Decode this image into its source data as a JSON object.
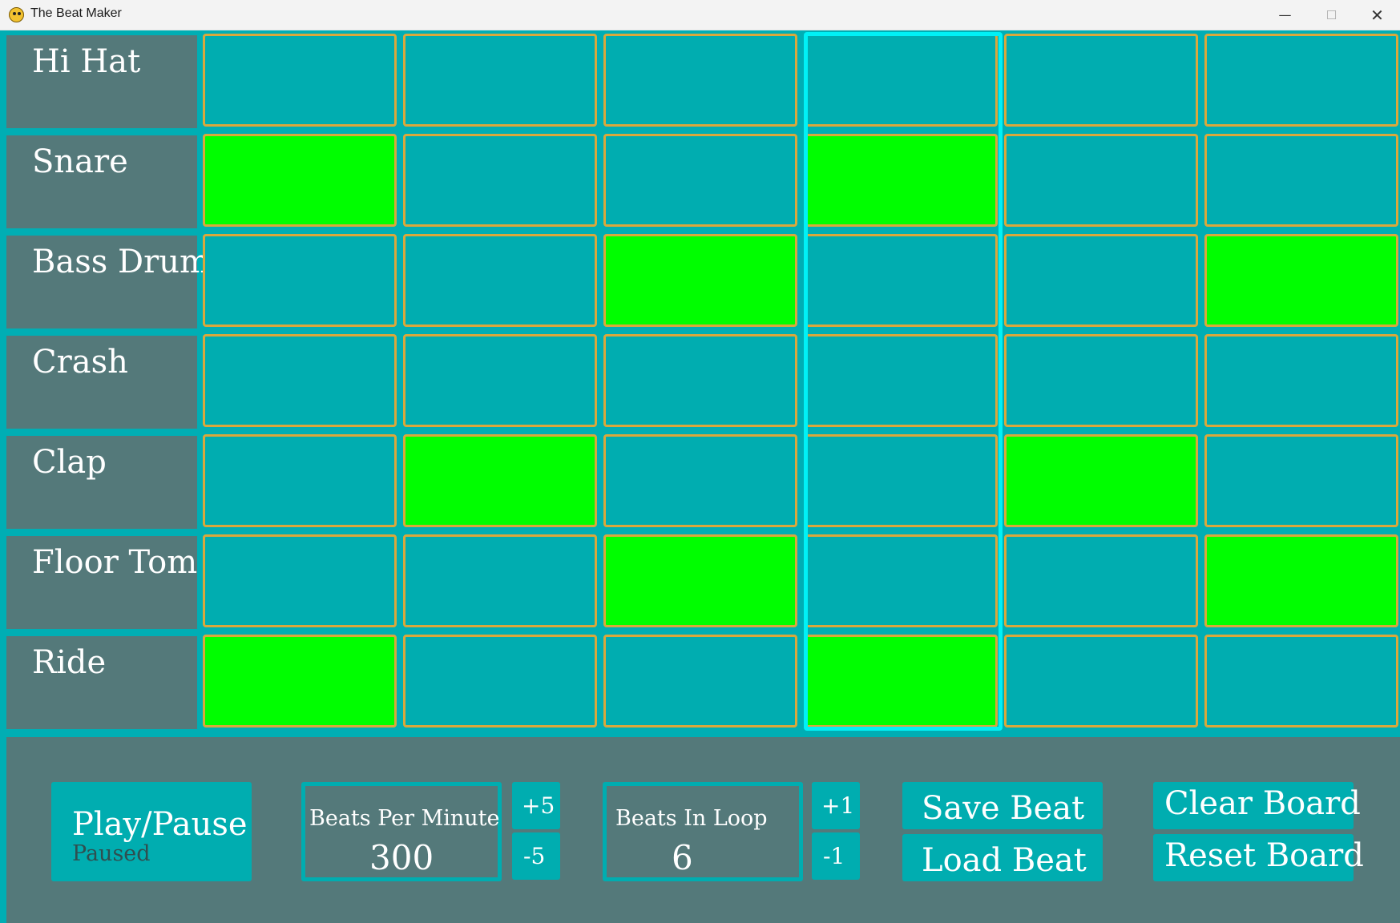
{
  "window": {
    "title": "The Beat Maker",
    "minimize_glyph": "—",
    "maximize_glyph": "☐",
    "close_glyph": "✕"
  },
  "instruments": [
    "Hi Hat",
    "Snare",
    "Bass Drum",
    "Crash",
    "Clap",
    "Floor Tom",
    "Ride"
  ],
  "grid": {
    "beats": 6,
    "active_beat_index": 3,
    "rows": [
      [
        false,
        false,
        false,
        false,
        false,
        false
      ],
      [
        true,
        false,
        false,
        true,
        false,
        false
      ],
      [
        false,
        false,
        true,
        false,
        false,
        true
      ],
      [
        false,
        false,
        false,
        false,
        false,
        false
      ],
      [
        false,
        true,
        false,
        false,
        true,
        false
      ],
      [
        false,
        false,
        true,
        false,
        false,
        true
      ],
      [
        true,
        false,
        false,
        true,
        false,
        false
      ]
    ]
  },
  "controls": {
    "play_pause_label": "Play/Pause",
    "play_state": "Paused",
    "bpm_title": "Beats Per Minute",
    "bpm_value": "300",
    "bpm_plus_label": "+5",
    "bpm_minus_label": "-5",
    "loop_title": "Beats In Loop",
    "loop_value": "6",
    "loop_plus_label": "+1",
    "loop_minus_label": "-1",
    "save_label": "Save Beat",
    "load_label": "Load Beat",
    "clear_label": "Clear Board",
    "reset_label": "Reset Board"
  },
  "colors": {
    "background": "#00aeb4",
    "panel": "#54797a",
    "cell_off": "#00adb0",
    "cell_on": "#00fe00",
    "cell_border": "#d9a83c",
    "active_column": "#00f1f6"
  }
}
